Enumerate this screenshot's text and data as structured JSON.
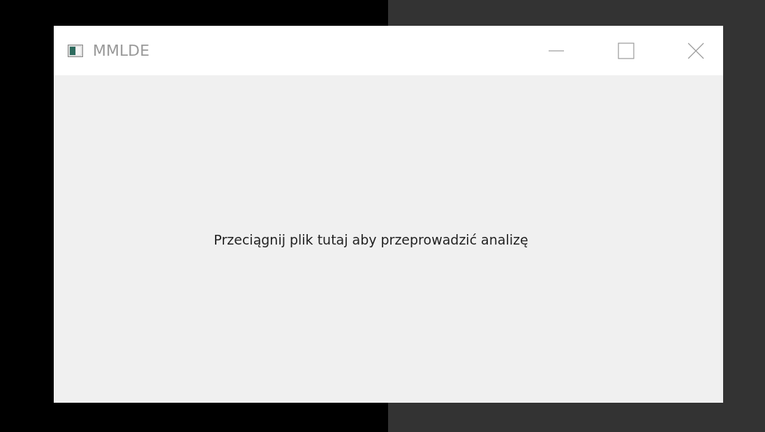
{
  "window": {
    "title": "MMLDE"
  },
  "content": {
    "message": "Przeciągnij plik tutaj aby przeprowadzić analizę"
  }
}
